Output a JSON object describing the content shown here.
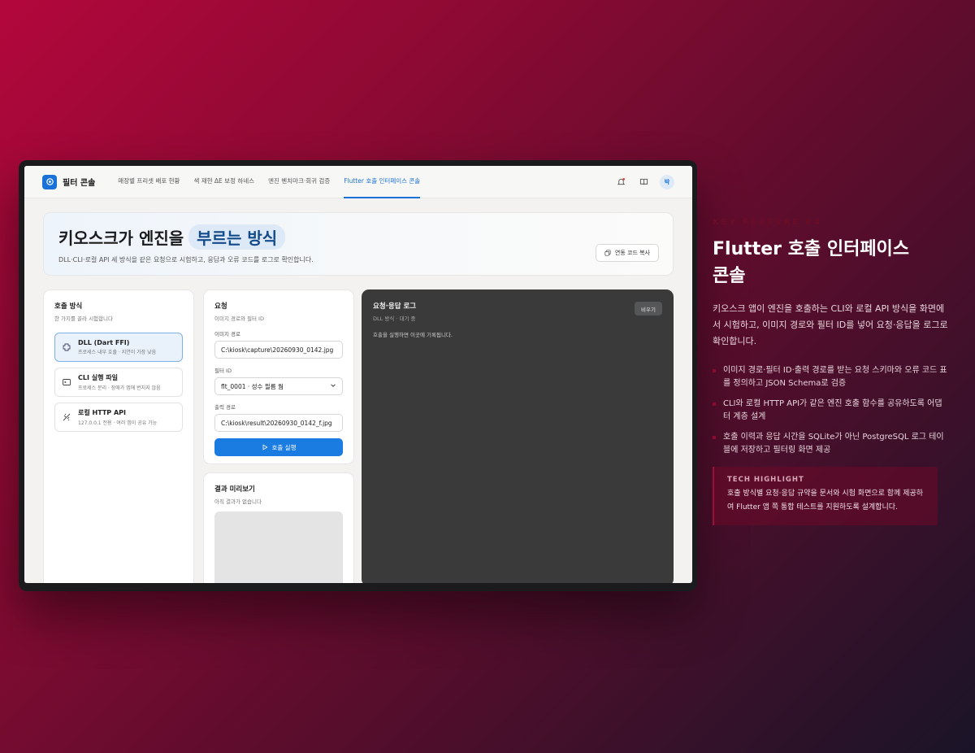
{
  "app": {
    "brand_title": "필터 콘솔",
    "nav_tabs": [
      {
        "label": "매장별 프리셋 배포 현황"
      },
      {
        "label": "색 재현 ΔE 보정 하네스"
      },
      {
        "label": "엔진 벤치마크·회귀 검증"
      },
      {
        "label": "Flutter 호출 인터페이스 콘솔"
      }
    ],
    "avatar_text": "박"
  },
  "hero": {
    "title_part1": "키오스크가 엔진을",
    "title_part2": "부르는 방식",
    "description": "DLL·CLI·로컬 API 세 방식을 같은 요청으로 시험하고, 응답과 오류 코드를 로그로 확인합니다.",
    "copy_button": "연동 코드 복사"
  },
  "methods_panel": {
    "title": "호출 방식",
    "subtitle": "한 가지를 골라 시험합니다",
    "items": [
      {
        "name": "DLL (Dart FFI)",
        "desc": "프로세스 내부 호출 · 지연이 가장 낮음",
        "icon": "plugin-icon",
        "selected": true
      },
      {
        "name": "CLI 실행 파일",
        "desc": "프로세스 분리 · 장애가 앱에 번지지 않음",
        "icon": "terminal-icon",
        "selected": false
      },
      {
        "name": "로컬 HTTP API",
        "desc": "127.0.0.1 전용 · 여러 앱이 공유 가능",
        "icon": "network-icon",
        "selected": false
      }
    ]
  },
  "request_panel": {
    "title": "요청",
    "subtitle": "이미지 경로와 필터 ID",
    "image_path_label": "이미지 경로",
    "image_path_value": "C:\\kiosk\\capture\\20260930_0142.jpg",
    "filter_id_label": "필터 ID",
    "filter_id_value": "flt_0001 · 성수 필름 웜",
    "output_path_label": "출력 경로",
    "output_path_value": "C:\\kiosk\\result\\20260930_0142_f.jpg",
    "run_button": "호출 실행"
  },
  "preview_panel": {
    "title": "결과 미리보기",
    "subtitle": "아직 결과가 없습니다"
  },
  "log_panel": {
    "title": "요청·응답 로그",
    "subtitle": "DLL 방식 · 대기 중",
    "clear_button": "비우기",
    "placeholder": "호출을 실행하면 이곳에 기록됩니다."
  },
  "side": {
    "eyebrow": "KEY FEATURE 04",
    "title_line1": "Flutter 호출 인터페이스",
    "title_line2": "콘솔",
    "description": "키오스크 앱이 엔진을 호출하는 CLI와 로컬 API 방식을 화면에서 시험하고, 이미지 경로와 필터 ID를 넣어 요청·응답을 로그로 확인합니다.",
    "bullets": [
      "이미지 경로·필터 ID·출력 경로를 받는 요청 스키마와 오류 코드 표를 정의하고 JSON Schema로 검증",
      "CLI와 로컬 HTTP API가 같은 엔진 호출 함수를 공유하도록 어댑터 계층 설계",
      "호출 이력과 응답 시간을 SQLite가 아닌 PostgreSQL 로그 테이블에 저장하고 필터링 화면 제공"
    ],
    "highlight_label": "TECH HIGHLIGHT",
    "highlight_text": "호출 방식별 요청·응답 규약을 문서와 시험 화면으로 함께 제공하여 Flutter 앱 쪽 통합 테스트를 지원하도록 설계합니다."
  },
  "colors": {
    "accent": "#1a72d9",
    "log_bg": "#3a3a3b",
    "bg_start": "#b3073c",
    "bg_end": "#1a1428"
  }
}
